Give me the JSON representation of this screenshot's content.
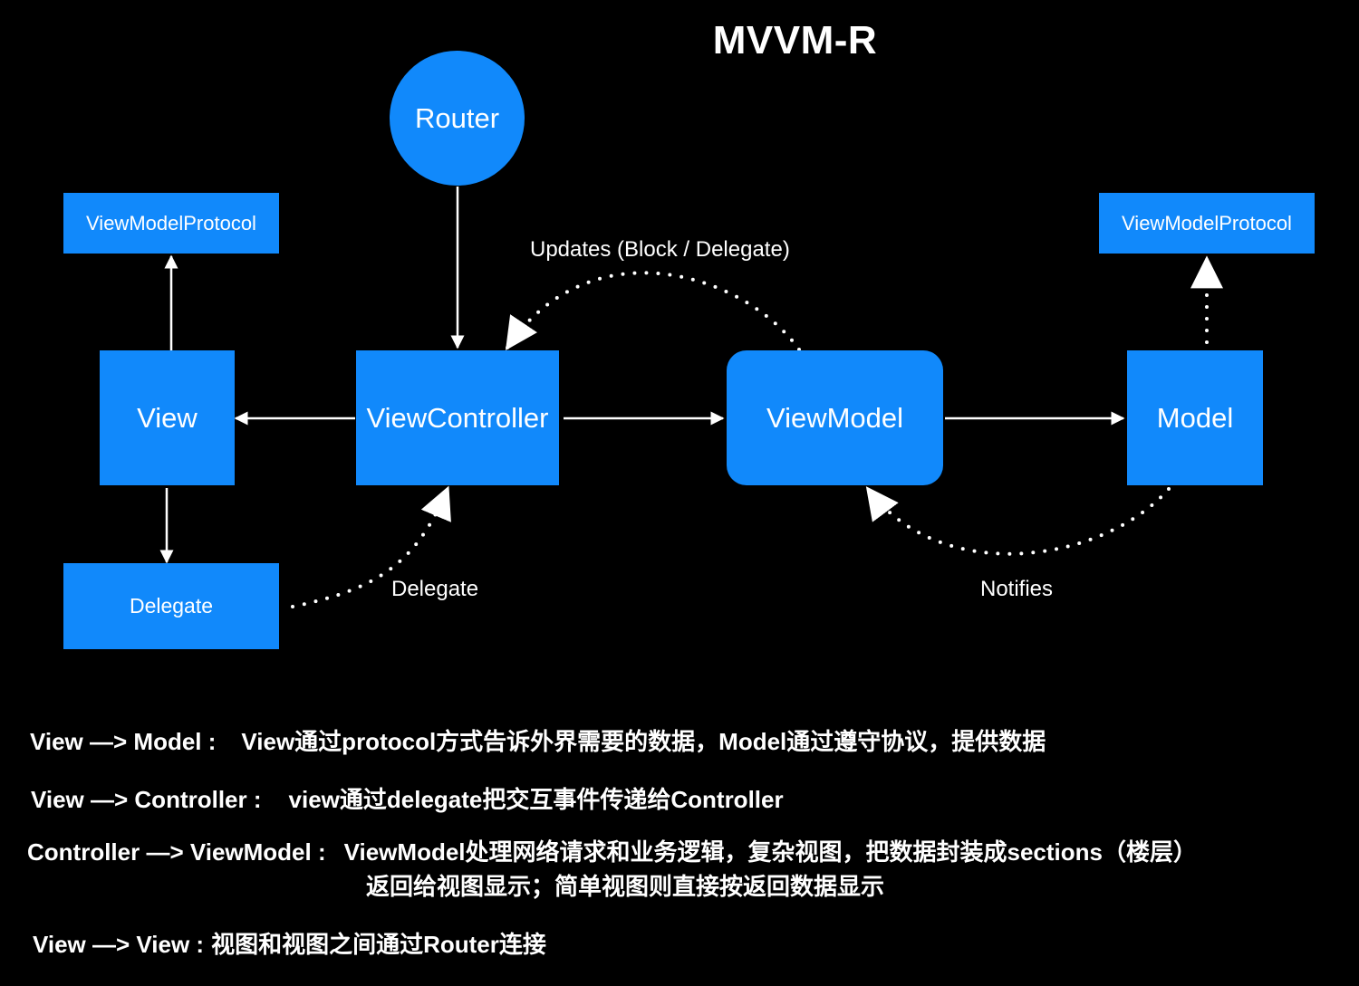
{
  "title": "MVVM-R",
  "nodes": {
    "router": "Router",
    "view": "View",
    "view_controller": "ViewController",
    "view_model": "ViewModel",
    "model": "Model",
    "delegate": "Delegate",
    "view_model_protocol_left": "ViewModelProtocol",
    "view_model_protocol_right": "ViewModelProtocol"
  },
  "edge_labels": {
    "updates": "Updates (Block / Delegate)",
    "delegate": "Delegate",
    "notifies": "Notifies"
  },
  "colors": {
    "node_fill": "#1189fb",
    "background": "#000000",
    "line": "#ffffff"
  },
  "notes": [
    {
      "key": "View  —> Model :",
      "text": "View通过protocol方式告诉外界需要的数据，Model通过遵守协议，提供数据"
    },
    {
      "key": "View  —>  Controller :",
      "text": "view通过delegate把交互事件传递给Controller"
    },
    {
      "key": "Controller  —> ViewModel :",
      "text": "ViewModel处理网络请求和业务逻辑，复杂视图，把数据封装成sections（楼层）",
      "text2": "返回给视图显示；简单视图则直接按返回数据显示"
    },
    {
      "key": "View  —>  View :",
      "text": "视图和视图之间通过Router连接"
    }
  ]
}
